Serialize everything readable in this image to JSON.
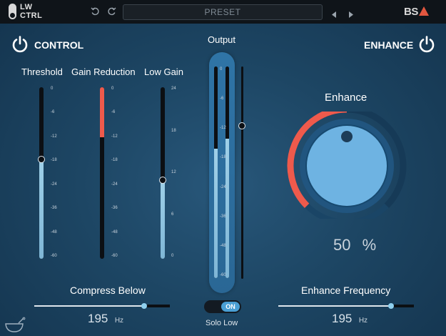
{
  "app": {
    "logo_text": "LW\nCTRL",
    "brand": "BS"
  },
  "toolbar": {
    "undo_icon": "undo-icon",
    "redo_icon": "redo-icon",
    "preset_label": "PRESET",
    "prev_icon": "triangle-left-icon",
    "next_icon": "triangle-right-icon"
  },
  "control": {
    "title": "CONTROL",
    "threshold": {
      "label": "Threshold",
      "ticks": [
        "0",
        "-6",
        "-12",
        "-18",
        "-24",
        "-36",
        "-48",
        "-60"
      ],
      "level": 0.58
    },
    "gain_reduction": {
      "label": "Gain Reduction",
      "ticks": [
        "0",
        "-6",
        "-12",
        "-18",
        "-24",
        "-36",
        "-48",
        "-60"
      ],
      "level": 0.29
    },
    "low_gain": {
      "label": "Low Gain",
      "ticks": [
        "24",
        "18",
        "12",
        "6",
        "0"
      ],
      "level": 0.46
    },
    "compress_below": {
      "label": "Compress Below",
      "value": "195",
      "unit": "Hz",
      "level": 0.81
    }
  },
  "output": {
    "label": "Output",
    "ticks": [
      "0",
      "-6",
      "-12",
      "-18",
      "-24",
      "-36",
      "-48",
      "-60"
    ],
    "meter_left_level": 0.61,
    "meter_right_level": 0.66,
    "gain_level": 0.72
  },
  "solo_low": {
    "label": "Solo Low",
    "state": "ON"
  },
  "enhance": {
    "title": "ENHANCE",
    "knob_label": "Enhance",
    "value": "50",
    "unit": "%",
    "level": 0.5,
    "frequency": {
      "label": "Enhance Frequency",
      "value": "195",
      "unit": "Hz",
      "level": 0.83
    }
  },
  "colors": {
    "accent_red": "#ee5a4c",
    "accent_blue": "#8fd0ef",
    "knob_face": "#6eb3e2",
    "background": "#1d4664"
  }
}
